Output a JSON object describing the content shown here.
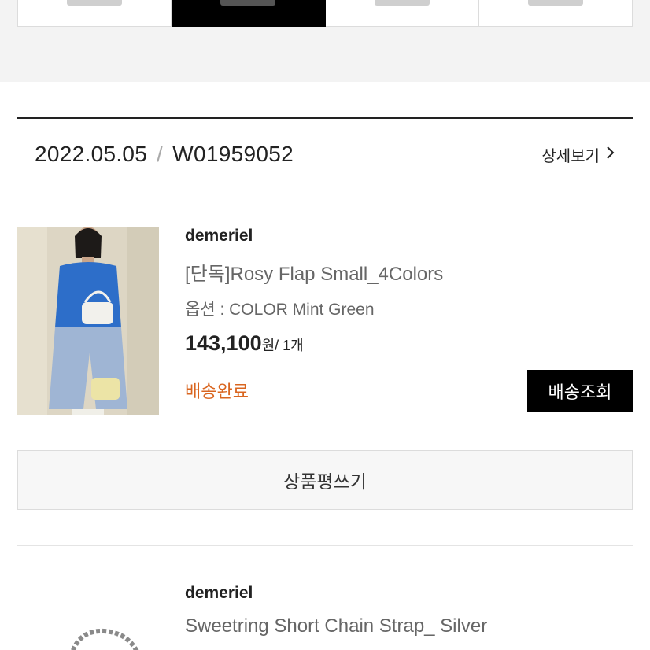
{
  "tabs": [
    {
      "label": "",
      "active": false
    },
    {
      "label": "",
      "active": true
    },
    {
      "label": "",
      "active": false
    },
    {
      "label": "",
      "active": false
    }
  ],
  "order": {
    "date": "2022.05.05",
    "separator": "/",
    "number": "W01959052",
    "detail_label": "상세보기"
  },
  "items": [
    {
      "brand": "demeriel",
      "name": "[단독]Rosy Flap Small_4Colors",
      "option": "옵션 : COLOR Mint Green",
      "price": "143,100",
      "price_suffix": "원/ 1개",
      "status": "배송완료",
      "track_label": "배송조회"
    },
    {
      "brand": "demeriel",
      "name": "Sweetring Short Chain Strap_ Silver"
    }
  ],
  "review_label": "상품평쓰기",
  "colors": {
    "accent_status": "#d9651f",
    "button_dark": "#000000",
    "page_band": "#f3f3f3"
  }
}
